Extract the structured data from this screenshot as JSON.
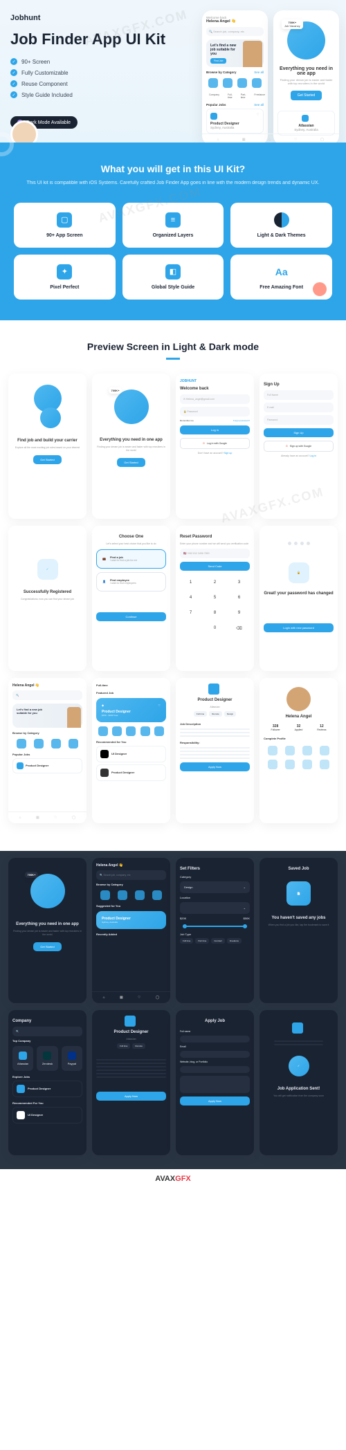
{
  "brand": "Jobhunt",
  "heroTitle": "Job Finder App UI Kit",
  "features": [
    "90+ Screen",
    "Fully Customizable",
    "Reuse Component",
    "Style Guide Included"
  ],
  "darkModeLabel": "Dark Mode Available",
  "phone1": {
    "greeting": "Welcome back",
    "user": "Helena Angel 👋",
    "searchPlaceholder": "Search job, company, etc",
    "bannerTitle": "Let's find a new job suitable for you",
    "bannerBtn": "Find Job",
    "browseLabel": "Browse by Category",
    "seeAll": "See all",
    "cats": [
      "Company",
      "Full-time",
      "Part-time",
      "Freelance"
    ],
    "popularLabel": "Popular Jobs",
    "jobTitle": "Product Designer",
    "jobLoc": "Sydney, Australia"
  },
  "phone2": {
    "stat1": "700K+",
    "stat1Label": "Job Vacancy",
    "title": "Everything you need in one app",
    "sub": "Finding your dream job is easier and faster with top recruiters in the world",
    "btn": "Get Started",
    "company": "Atlassian",
    "companyLoc": "Sydney, Australia"
  },
  "blueSection": {
    "title": "What you will get in this UI Kit?",
    "desc": "This UI kit is compatible with iOS Systems. Carefully crafted Job Finder App goes in line with the modern design trends and dynamic UX.",
    "cards": [
      "90+ App Screen",
      "Organized Layers",
      "Light & Dark Themes",
      "Pixel Perfect",
      "Global Style Guide",
      "Free Amazing Font"
    ]
  },
  "previewTitle": "Preview Screen in Light & Dark mode",
  "screens": {
    "onboard1": {
      "title": "Find job and build your carrier",
      "sub": "Explore all the most exciting job roles based on your interest",
      "btn": "Get Started"
    },
    "onboard2": {
      "title": "Everything you need in one app",
      "btn": "Get Started"
    },
    "login": {
      "brand": "JOBHUNT",
      "title": "Welcome back",
      "email": "Helena_angel@gmail.com",
      "pwdPlaceholder": "Password",
      "remember": "Remember me",
      "forgot": "Forgot password?",
      "btn": "Log in",
      "google": "Log in with Google",
      "signupPrompt": "Don't have an account?",
      "signupLink": "Sign up"
    },
    "signup": {
      "title": "Sign Up",
      "namePlaceholder": "Full Name",
      "emailPlaceholder": "E-mail",
      "pwdPlaceholder": "Password",
      "btn": "Sign Up",
      "google": "Sign up with Google",
      "loginPrompt": "Already have an account?",
      "loginLink": "Log in"
    },
    "registered": {
      "title": "Successfully Registered",
      "sub": "Congratulations, now you can find your dream job"
    },
    "choose": {
      "title": "Choose One",
      "sub": "Let's select your best choice that you like to do",
      "opt1": "Find a job",
      "opt1Sub": "I want to find a job for me",
      "opt2": "Find employee",
      "opt2Sub": "I want to find employees",
      "btn": "Continue"
    },
    "reset": {
      "title": "Reset Password",
      "sub": "Enter your phone number and we will send you verification code",
      "phone": "+062 812 3456 7890",
      "btn": "Send Code"
    },
    "changed": {
      "title": "Great! your password has changed",
      "btn": "Login with new password"
    },
    "home": {
      "featured": "Featured Job",
      "jobTitle": "Product Designer",
      "company": "Atlassian",
      "salary": "$45K - $60K/Year",
      "recommended": "Recommended for You",
      "apply": "Apply Now"
    },
    "fullTime": {
      "title": "Full-time",
      "recommended": "Recommended for You",
      "uiDesigner": "UI Designer"
    },
    "jobDetail": {
      "title": "Product Designer",
      "company": "Atlassian",
      "descLabel": "Job Description",
      "respLabel": "Responsibility:",
      "btn": "Apply Now"
    },
    "profile": {
      "name": "Helena Angel",
      "stat1": "328",
      "stat1Label": "Follower",
      "stat2": "32",
      "stat2Label": "Applied",
      "stat3": "12",
      "stat3Label": "Reviews",
      "section": "Complete Profile"
    },
    "darkHome": {
      "suggested": "Suggested for You",
      "recently": "Recently Added"
    },
    "filters": {
      "title": "Set Filters",
      "category": "Category",
      "catVal": "Design",
      "location": "Location",
      "salaryRange": "Salary Range",
      "min": "$20K",
      "max": "$50K",
      "jobType": "Job Type",
      "types": [
        "Full time",
        "Part time",
        "Contract",
        "Freelance"
      ]
    },
    "saved": {
      "title": "Saved Job",
      "emptyTitle": "You haven't saved any jobs",
      "emptySub": "When you find a job you like, tap the bookmark to save it"
    },
    "companyList": {
      "title": "Company",
      "topLabel": "Top Company",
      "companies": [
        "Atlassian",
        "Zendesk",
        "Paypal"
      ],
      "exploreLabel": "Explore Jobs",
      "recLabel": "Recommended For You"
    },
    "companyDetail": {
      "name": "Atlassian",
      "loc": "Sydney, Australia",
      "job": "Product Designer"
    },
    "apply": {
      "title": "Apply Job",
      "name": "Full name",
      "email": "Email",
      "website": "Website, blog, or Portfolio",
      "btn": "Apply Now"
    },
    "applied": {
      "title": "Job Application Sent!",
      "sub": "You will get notification from the company soon"
    }
  },
  "watermark": "AVAXGFX.COM",
  "footerLogo": {
    "part1": "AVAX",
    "part2": "GFX"
  }
}
